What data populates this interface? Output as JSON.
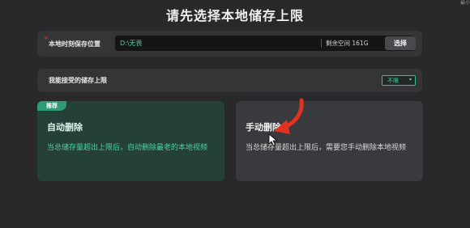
{
  "corner": {
    "text": "最小"
  },
  "page": {
    "title": "请先选择本地储存上限"
  },
  "location_row": {
    "required_mark": "*",
    "label": "本地时刻保存位置",
    "path": "D:\\无畏",
    "space_text": "剩余空间 161G",
    "choose_button": "选择"
  },
  "limit_row": {
    "label": "我能接受的储存上限",
    "selected": "不限",
    "caret": "▾"
  },
  "cards": {
    "auto": {
      "badge": "推荐",
      "title": "自动删除",
      "desc": "当总储存量超出上限后，自动删除最老的本地视频"
    },
    "manual": {
      "title": "手动删除",
      "desc": "当总储存量超出上限后，需要您手动删除本地视频"
    }
  },
  "colors": {
    "accent_green": "#4fd1a5",
    "annotation_red": "#e0321e",
    "background": "#29292b"
  },
  "icons": {
    "annotation": "red-curved-arrow-icon",
    "pointer": "mouse-cursor-icon"
  }
}
